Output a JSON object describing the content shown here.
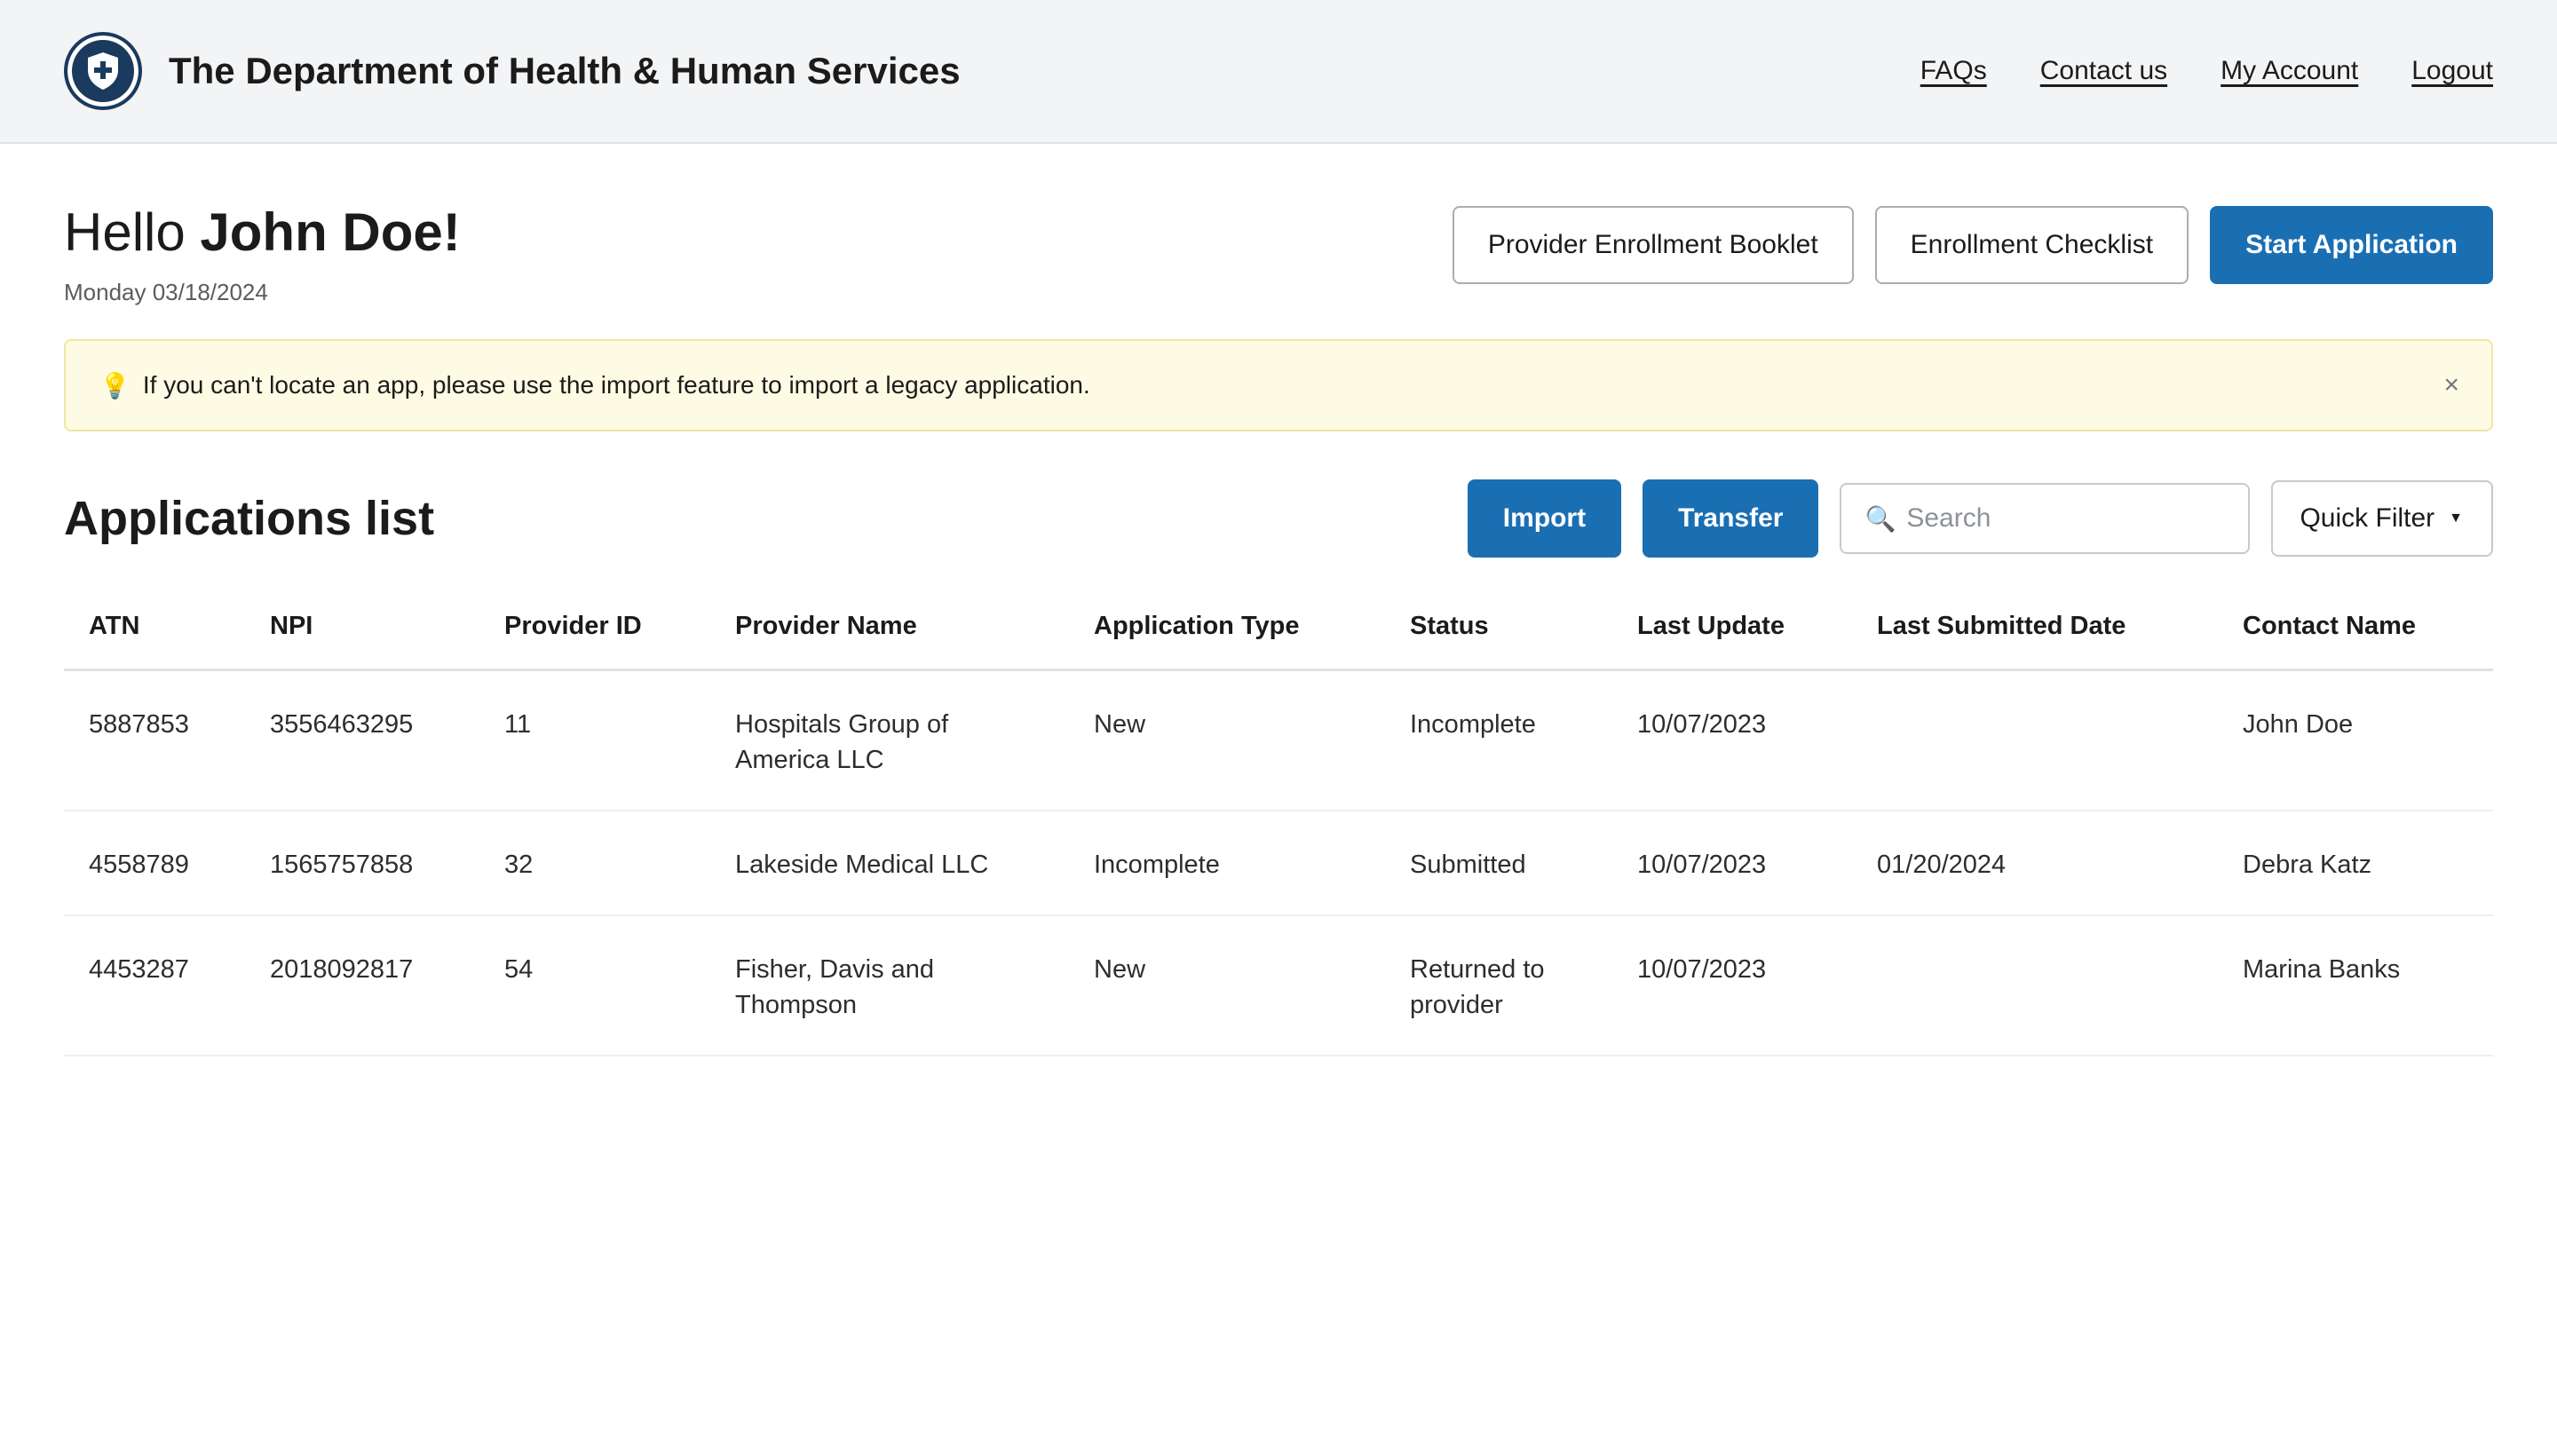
{
  "header": {
    "title": "The Department of Health & Human Services",
    "nav": [
      "FAQs",
      "Contact us",
      "My Account",
      "Logout"
    ]
  },
  "greeting": {
    "hello": "Hello",
    "name": "John Doe!",
    "date": "Monday 03/18/2024"
  },
  "actions": {
    "booklet": "Provider Enrollment Booklet",
    "checklist": "Enrollment Checklist",
    "start": "Start Application"
  },
  "alert": {
    "text": "If you can't locate an app, please use the import feature to import a legacy application.",
    "close": "×"
  },
  "list": {
    "title": "Applications list",
    "import": "Import",
    "transfer": "Transfer",
    "search_placeholder": "Search",
    "quick_filter": "Quick Filter"
  },
  "table": {
    "columns": [
      "ATN",
      "NPI",
      "Provider ID",
      "Provider Name",
      "Application Type",
      "Status",
      "Last Update",
      "Last Submitted Date",
      "Contact Name"
    ],
    "rows": [
      [
        "5887853",
        "3556463295",
        "11",
        "Hospitals Group of America LLC",
        "New",
        "Incomplete",
        "10/07/2023",
        "",
        "John Doe"
      ],
      [
        "4558789",
        "1565757858",
        "32",
        "Lakeside Medical LLC",
        "Incomplete",
        "Submitted",
        "10/07/2023",
        "01/20/2024",
        "Debra Katz"
      ],
      [
        "4453287",
        "2018092817",
        "54",
        "Fisher, Davis and Thompson",
        "New",
        "Returned to provider",
        "10/07/2023",
        "",
        "Marina Banks"
      ]
    ]
  },
  "colors": {
    "primary": "#1a6fb3",
    "logo": "#1a3a5e",
    "alert_bg": "#fdfbe3"
  },
  "icons": [
    "shield-plus-icon",
    "lightbulb-icon",
    "close-icon",
    "search-icon",
    "caret-down-icon"
  ]
}
